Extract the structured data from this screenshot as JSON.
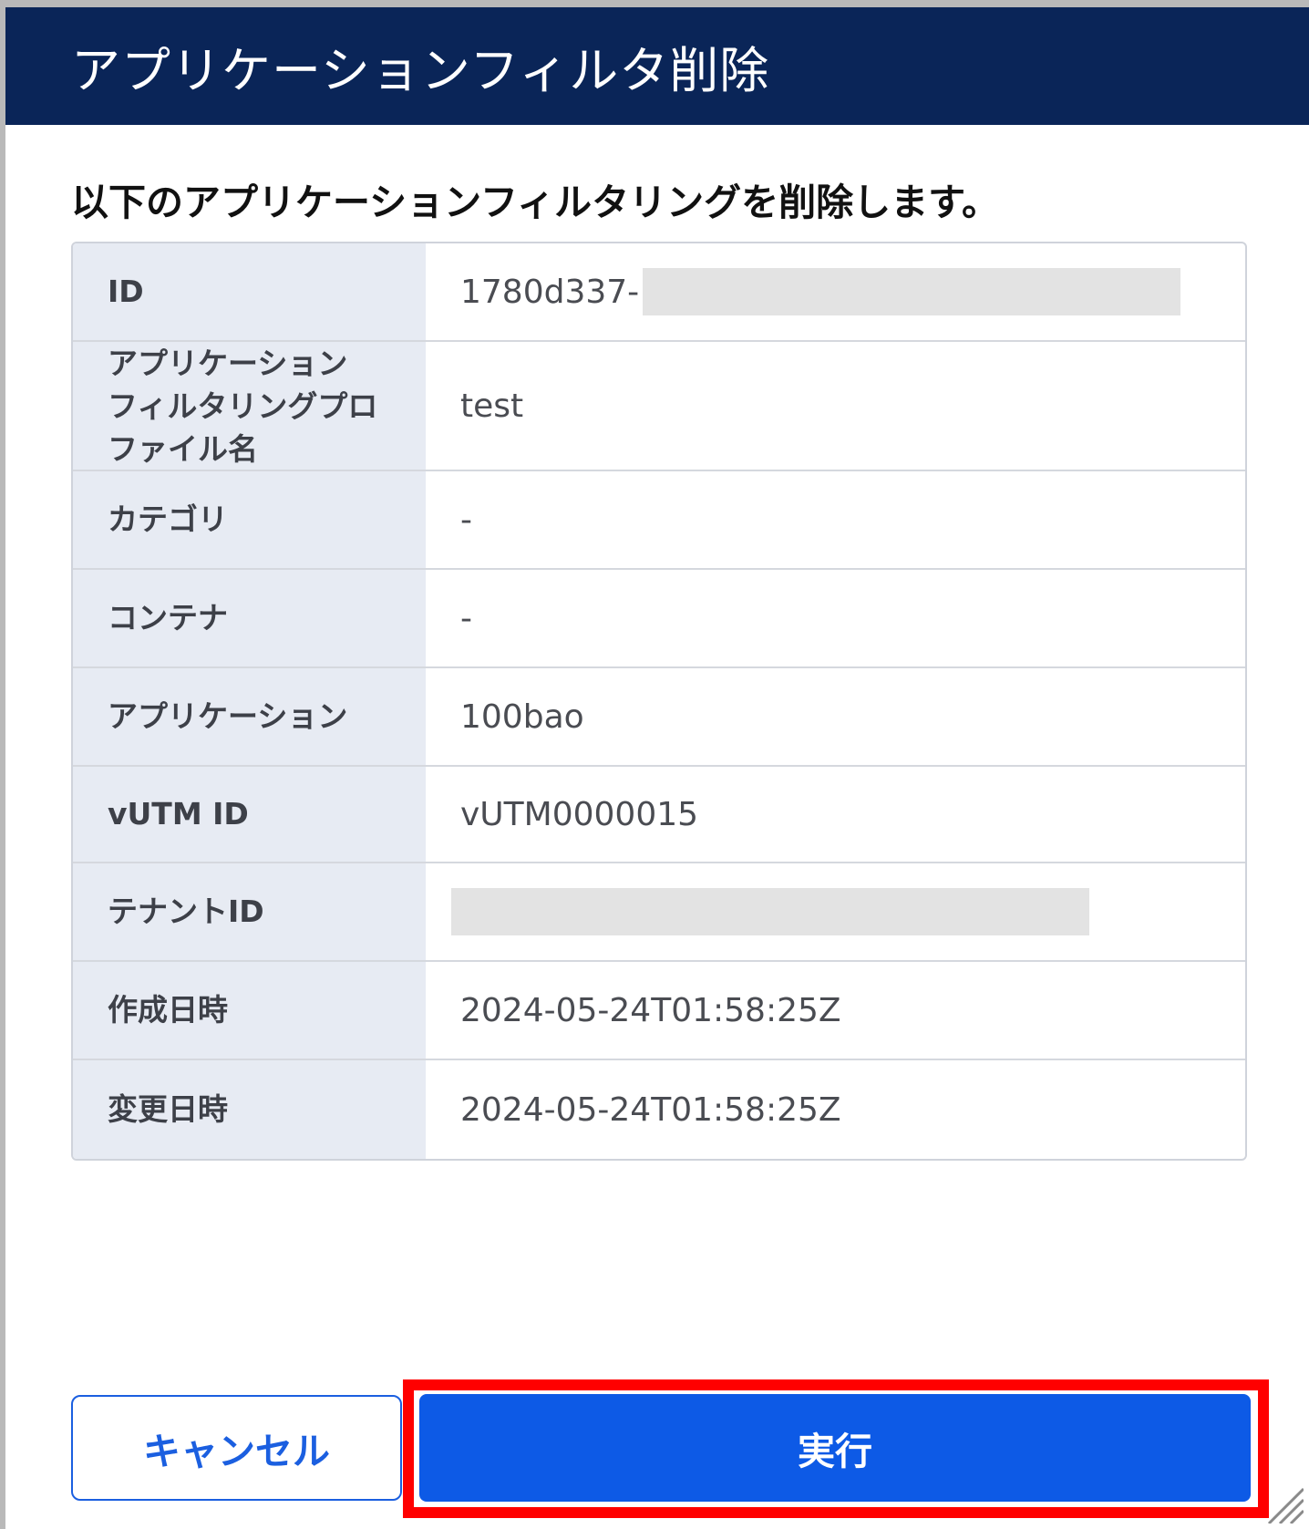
{
  "dialog": {
    "title": "アプリケーションフィルタ削除",
    "message": "以下のアプリケーションフィルタリングを削除します。"
  },
  "details": [
    {
      "label": "ID",
      "value": "1780d337-",
      "redacted": true
    },
    {
      "label": "アプリケーションフィルタリングプロファイル名",
      "label_lines": [
        "アプリケーション",
        "フィルタリングプロ",
        "ファイル名"
      ],
      "value": "test"
    },
    {
      "label": "カテゴリ",
      "value": "-"
    },
    {
      "label": "コンテナ",
      "value": "-"
    },
    {
      "label": "アプリケーション",
      "value": "100bao"
    },
    {
      "label": "vUTM ID",
      "value": "vUTM0000015"
    },
    {
      "label": "テナントID",
      "value": "",
      "redacted": true
    },
    {
      "label": "作成日時",
      "value": "2024-05-24T01:58:25Z"
    },
    {
      "label": "変更日時",
      "value": "2024-05-24T01:58:25Z"
    }
  ],
  "buttons": {
    "cancel_label": "キャンセル",
    "execute_label": "実行"
  },
  "colors": {
    "header_bg": "#0a2558",
    "primary": "#0d5ae6",
    "highlight": "#ff0000"
  }
}
